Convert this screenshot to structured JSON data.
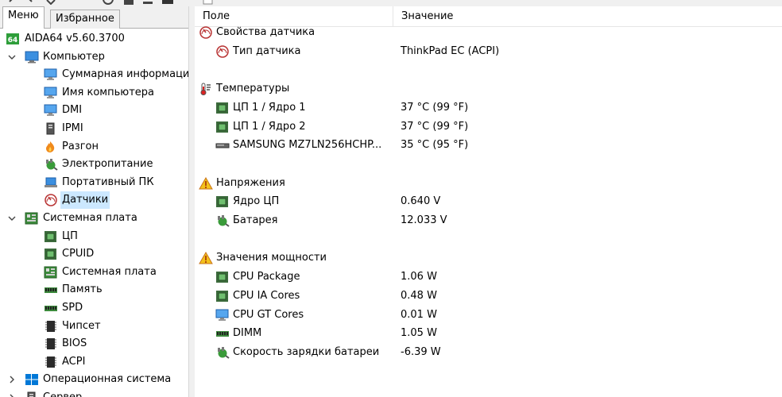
{
  "tabs": {
    "menu": "Меню",
    "favorites": "Избранное"
  },
  "tree": [
    {
      "label": "AIDA64 v5.60.3700",
      "icon": "aida64-logo-icon",
      "level": 0
    },
    {
      "label": "Компьютер",
      "icon": "computer-icon",
      "level": 0,
      "expanded": true
    },
    {
      "label": "Суммарная информация",
      "icon": "monitor-icon",
      "level": 1
    },
    {
      "label": "Имя компьютера",
      "icon": "monitor-icon",
      "level": 1
    },
    {
      "label": "DMI",
      "icon": "monitor-icon",
      "level": 1
    },
    {
      "label": "IPMI",
      "icon": "server-icon",
      "level": 1
    },
    {
      "label": "Разгон",
      "icon": "flame-icon",
      "level": 1
    },
    {
      "label": "Электропитание",
      "icon": "power-plug-icon",
      "level": 1
    },
    {
      "label": "Портативный ПК",
      "icon": "laptop-icon",
      "level": 1
    },
    {
      "label": "Датчики",
      "icon": "gauge-icon",
      "level": 1,
      "selected": true
    },
    {
      "label": "Системная плата",
      "icon": "motherboard-icon",
      "level": 0,
      "expanded": true
    },
    {
      "label": "ЦП",
      "icon": "cpu-chip-icon",
      "level": 1
    },
    {
      "label": "CPUID",
      "icon": "cpu-chip-icon",
      "level": 1
    },
    {
      "label": "Системная плата",
      "icon": "motherboard-icon",
      "level": 1
    },
    {
      "label": "Память",
      "icon": "memory-module-icon",
      "level": 1
    },
    {
      "label": "SPD",
      "icon": "memory-module-icon",
      "level": 1
    },
    {
      "label": "Чипсет",
      "icon": "chipset-icon",
      "level": 1
    },
    {
      "label": "BIOS",
      "icon": "chipset-icon",
      "level": 1
    },
    {
      "label": "ACPI",
      "icon": "chipset-icon",
      "level": 1
    },
    {
      "label": "Операционная система",
      "icon": "windows-logo-icon",
      "level": 0,
      "expanded": false
    },
    {
      "label": "Сервер",
      "icon": "server-icon",
      "level": 0,
      "expanded": false
    }
  ],
  "columns": {
    "field": "Поле",
    "value": "Значение"
  },
  "rows": [
    {
      "type": "group",
      "field": "Свойства датчика",
      "value": "",
      "icon": "gauge-icon"
    },
    {
      "type": "item",
      "field": "Тип датчика",
      "value": "ThinkPad EC  (ACPI)",
      "icon": "gauge-icon"
    },
    {
      "type": "spacer"
    },
    {
      "type": "group",
      "field": "Температуры",
      "value": "",
      "icon": "thermometer-icon"
    },
    {
      "type": "item",
      "field": "ЦП 1 / Ядро 1",
      "value": "37 °C  (99 °F)",
      "icon": "cpu-chip-icon"
    },
    {
      "type": "item",
      "field": "ЦП 1 / Ядро 2",
      "value": "37 °C  (99 °F)",
      "icon": "cpu-chip-icon"
    },
    {
      "type": "item",
      "field": "SAMSUNG MZ7LN256HCHP...",
      "value": "35 °C  (95 °F)",
      "icon": "disk-drive-icon"
    },
    {
      "type": "spacer"
    },
    {
      "type": "group",
      "field": "Напряжения",
      "value": "",
      "icon": "warning-icon"
    },
    {
      "type": "item",
      "field": "Ядро ЦП",
      "value": "0.640 V",
      "icon": "cpu-chip-icon"
    },
    {
      "type": "item",
      "field": "Батарея",
      "value": "12.033 V",
      "icon": "power-plug-icon"
    },
    {
      "type": "spacer"
    },
    {
      "type": "group",
      "field": "Значения мощности",
      "value": "",
      "icon": "warning-icon"
    },
    {
      "type": "item",
      "field": "CPU Package",
      "value": "1.06 W",
      "icon": "cpu-chip-icon"
    },
    {
      "type": "item",
      "field": "CPU IA Cores",
      "value": "0.48 W",
      "icon": "cpu-chip-icon"
    },
    {
      "type": "item",
      "field": "CPU GT Cores",
      "value": "0.01 W",
      "icon": "monitor-icon"
    },
    {
      "type": "item",
      "field": "DIMM",
      "value": "1.05 W",
      "icon": "memory-module-icon"
    },
    {
      "type": "item",
      "field": "Скорость зарядки батареи",
      "value": "-6.39 W",
      "icon": "power-plug-icon"
    }
  ],
  "colors": {
    "selection": "#cce8ff",
    "chip_green": "#3c8a3c",
    "monitor_blue": "#2a7fd4",
    "warning_yellow": "#f3c21c"
  }
}
